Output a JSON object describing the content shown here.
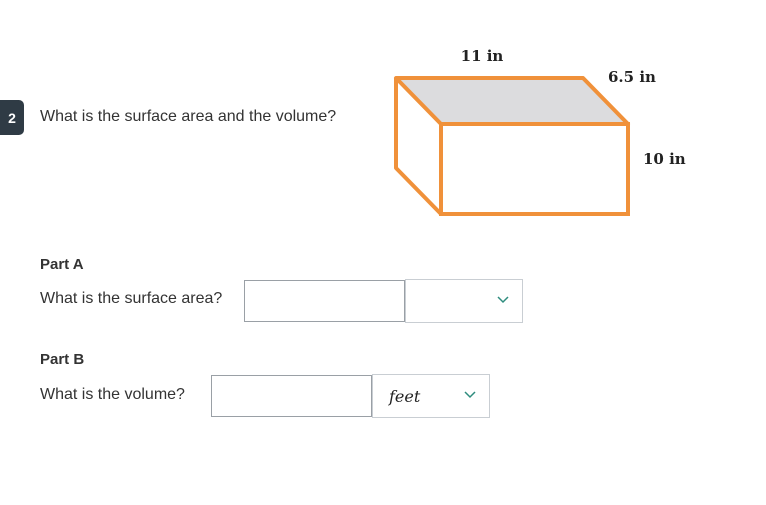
{
  "question": {
    "number": "2",
    "prompt": "What is the surface area and the volume?"
  },
  "figure": {
    "length_label": "11 in",
    "depth_label": "6.5 in",
    "height_label": "10 in",
    "colors": {
      "edge": "#f0913a",
      "top_face": "#dcdcde"
    }
  },
  "part_a": {
    "title": "Part A",
    "question": "What is the surface area?",
    "answer_value": "",
    "unit_selected": ""
  },
  "part_b": {
    "title": "Part B",
    "question": "What is the volume?",
    "answer_value": "",
    "unit_selected": "feet"
  },
  "icons": {
    "dropdown": "chevron-down-icon"
  },
  "colors": {
    "badge_bg": "#2f3b45",
    "chevron": "#2e8c7e"
  }
}
